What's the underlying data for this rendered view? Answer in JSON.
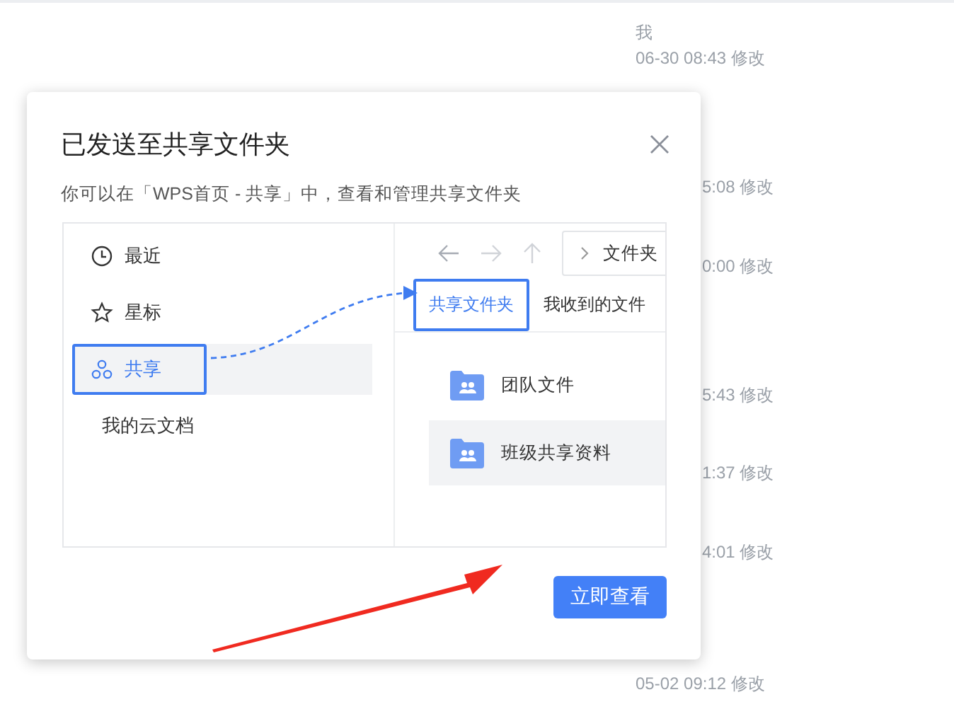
{
  "background_list": [
    {
      "kind": "full",
      "owner": "我",
      "modified": "06-30 08:43 修改"
    },
    {
      "kind": "clipped",
      "modified": "5:08 修改"
    },
    {
      "kind": "clipped",
      "modified": "0:00 修改"
    },
    {
      "kind": "clipped",
      "modified": "5:43 修改"
    },
    {
      "kind": "clipped",
      "modified": "1:37 修改"
    },
    {
      "kind": "clipped",
      "modified": "4:01 修改"
    },
    {
      "kind": "full",
      "modified": "05-02 09:12 修改"
    }
  ],
  "dialog": {
    "title": "已发送至共享文件夹",
    "subtitle": "你可以在「WPS首页 - 共享」中，查看和管理共享文件夹",
    "illustration": {
      "nav": [
        {
          "label": "最近",
          "selected": false
        },
        {
          "label": "星标",
          "selected": false
        },
        {
          "label": "共享",
          "selected": true
        },
        {
          "label": "我的云文档",
          "selected": false
        }
      ],
      "breadcrumb": "文件夹",
      "tabs": [
        {
          "label": "共享文件夹",
          "selected": true
        },
        {
          "label": "我收到的文件",
          "selected": false
        }
      ],
      "folders": [
        {
          "name": "团队文件",
          "selected": false
        },
        {
          "name": "班级共享资料",
          "selected": true
        }
      ]
    },
    "button": "立即查看"
  }
}
